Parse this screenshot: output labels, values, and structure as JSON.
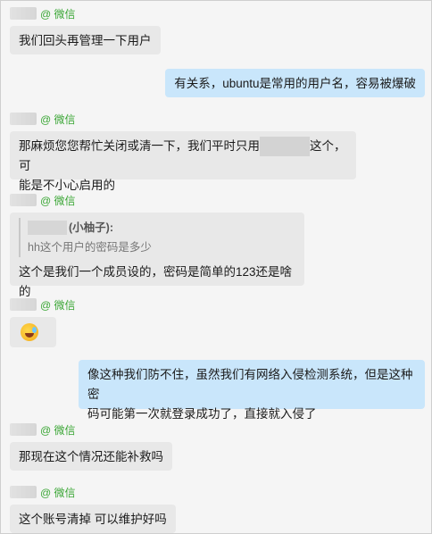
{
  "messages": [
    {
      "source": "@ 微信",
      "text": "我们回头再管理一下用户"
    },
    {
      "text": "有关系，ubuntu是常用的用户名，容易被爆破"
    },
    {
      "source": "@ 微信",
      "text_a": "那麻烦您您帮忙关闭或清一下，我们平时只用",
      "text_b": "这个，可",
      "text_c": "能是不小心启用的"
    },
    {
      "source": "@ 微信",
      "quote_name": "(小柚子):",
      "quote_text": "hh这个用户的密码是多少",
      "text": "这个是我们一个成员设的，密码是简单的123还是啥的"
    },
    {
      "source": "@ 微信",
      "emoji": "grimacing-sweat-emoji"
    },
    {
      "text_a": "像这种我们防不住，虽然我们有网络入侵检测系统，但是这种密",
      "text_b": "码可能第一次就登录成功了，直接就入侵了"
    },
    {
      "source": "@ 微信",
      "text": "那现在这个情况还能补救吗"
    },
    {
      "source": "@ 微信",
      "text": "这个账号清掉 可以维护好吗"
    }
  ],
  "colors": {
    "incoming": "#e8e8e8",
    "outgoing": "#c9e6fb",
    "source_green": "#3aa635"
  }
}
